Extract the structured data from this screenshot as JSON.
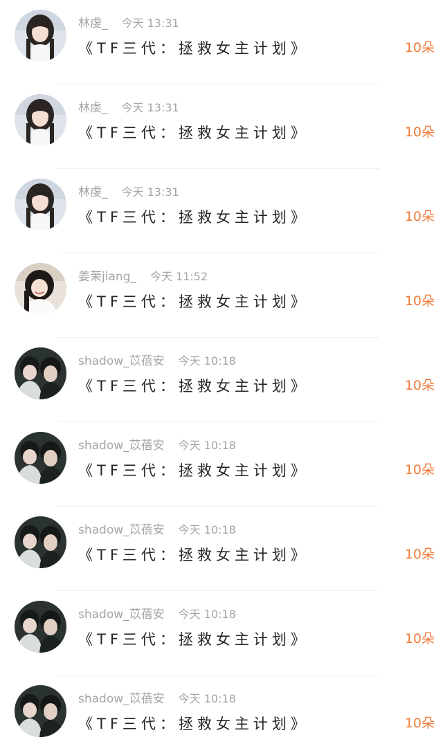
{
  "items": [
    {
      "user": "林虔_",
      "time": "今天 13:31",
      "title": "《TF三代：拯救女主计划》",
      "reward": "10朵",
      "avatar": "girl-dark-hair-avatar"
    },
    {
      "user": "林虔_",
      "time": "今天 13:31",
      "title": "《TF三代：拯救女主计划》",
      "reward": "10朵",
      "avatar": "girl-dark-hair-avatar"
    },
    {
      "user": "林虔_",
      "time": "今天 13:31",
      "title": "《TF三代：拯救女主计划》",
      "reward": "10朵",
      "avatar": "girl-dark-hair-avatar"
    },
    {
      "user": "姜茉jiang_",
      "time": "今天 11:52",
      "title": "《TF三代：拯救女主计划》",
      "reward": "10朵",
      "avatar": "girl-smiling-avatar"
    },
    {
      "user": "shadow_苡蓓安",
      "time": "今天 10:18",
      "title": "《TF三代：拯救女主计划》",
      "reward": "10朵",
      "avatar": "two-boys-avatar"
    },
    {
      "user": "shadow_苡蓓安",
      "time": "今天 10:18",
      "title": "《TF三代：拯救女主计划》",
      "reward": "10朵",
      "avatar": "two-boys-avatar"
    },
    {
      "user": "shadow_苡蓓安",
      "time": "今天 10:18",
      "title": "《TF三代：拯救女主计划》",
      "reward": "10朵",
      "avatar": "two-boys-avatar"
    },
    {
      "user": "shadow_苡蓓安",
      "time": "今天 10:18",
      "title": "《TF三代：拯救女主计划》",
      "reward": "10朵",
      "avatar": "two-boys-avatar"
    },
    {
      "user": "shadow_苡蓓安",
      "time": "今天 10:18",
      "title": "《TF三代：拯救女主计划》",
      "reward": "10朵",
      "avatar": "two-boys-avatar"
    }
  ],
  "colors": {
    "username": "#a4a4a4",
    "title": "#262626",
    "reward": "#f07a3a",
    "divider": "#f0f0f0"
  }
}
